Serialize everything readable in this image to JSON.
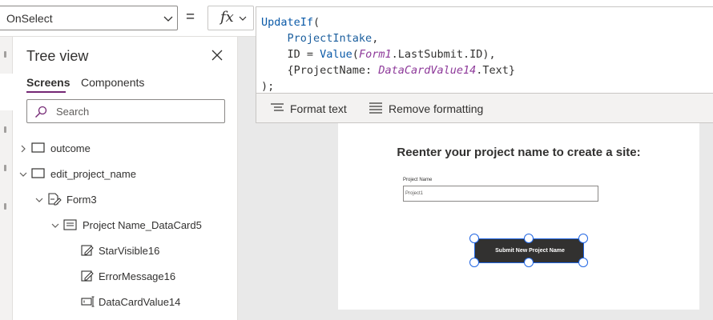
{
  "formula_bar": {
    "property": "OnSelect",
    "equals": "=",
    "fx": "fx",
    "code": {
      "fn_update": "UpdateIf",
      "open": "(",
      "table": "ProjectIntake",
      "comma1": ",",
      "id_lhs": "ID = ",
      "fn_value": "Value",
      "form": "Form1",
      "lastsubmit": ".LastSubmit.ID)",
      "comma2": ",",
      "rec_open": "{ProjectName: ",
      "datacard": "DataCardValue14",
      "text_prop": ".Text}",
      "close": ");"
    },
    "format_text": "Format text",
    "remove_formatting": "Remove formatting"
  },
  "tree_view": {
    "title": "Tree view",
    "tabs": [
      "Screens",
      "Components"
    ],
    "search_placeholder": "Search",
    "nodes": [
      {
        "label": "outcome",
        "icon": "screen-icon",
        "expanded": false
      },
      {
        "label": "edit_project_name",
        "icon": "screen-icon",
        "expanded": true
      },
      {
        "label": "Form3",
        "icon": "form-icon",
        "expanded": true
      },
      {
        "label": "Project Name_DataCard5",
        "icon": "datacard-icon",
        "expanded": true
      },
      {
        "label": "StarVisible16",
        "icon": "label-edit-icon"
      },
      {
        "label": "ErrorMessage16",
        "icon": "label-edit-icon"
      },
      {
        "label": "DataCardValue14",
        "icon": "textinput-icon"
      }
    ]
  },
  "canvas": {
    "heading": "Reenter your project name to create a site:",
    "field_label": "Project Name",
    "field_value": "Project1",
    "button_label": "Submit New Project Name"
  },
  "colors": {
    "accent": "#742774",
    "selection": "#2266e3",
    "button_bg": "#323130",
    "keyword": "#0b5aa8",
    "control_ref": "#8e3a9a"
  }
}
